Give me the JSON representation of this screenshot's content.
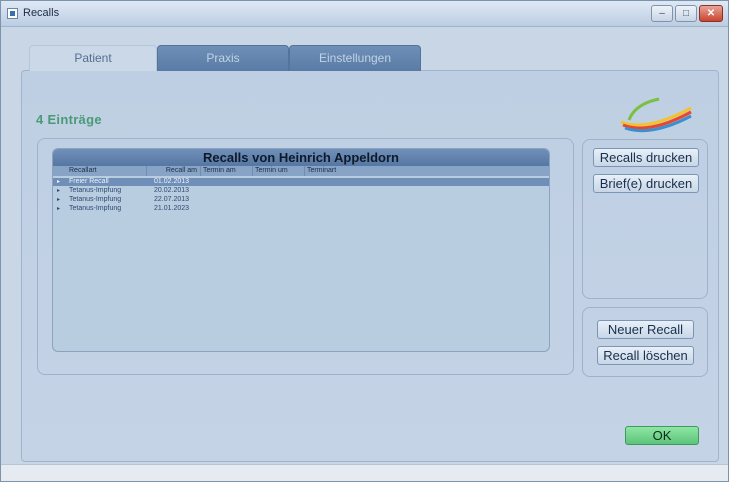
{
  "window": {
    "title": "Recalls"
  },
  "tabs": [
    {
      "label": "Patient"
    },
    {
      "label": "Praxis"
    },
    {
      "label": "Einstellungen"
    }
  ],
  "entry_count": "4 Einträge",
  "grid": {
    "title": "Recalls von Heinrich Appeldorn",
    "columns": [
      "Recallart",
      "Recall am",
      "Termin am",
      "Termin um",
      "Terminart"
    ],
    "rows": [
      {
        "recallart": "Freier Recall",
        "recall_am": "01.02.2013",
        "termin_am": "",
        "termin_um": "",
        "terminart": ""
      },
      {
        "recallart": "Tetanus-Impfung",
        "recall_am": "20.02.2013",
        "termin_am": "",
        "termin_um": "",
        "terminart": ""
      },
      {
        "recallart": "Tetanus-Impfung",
        "recall_am": "22.07.2013",
        "termin_am": "",
        "termin_um": "",
        "terminart": ""
      },
      {
        "recallart": "Tetanus-Impfung",
        "recall_am": "21.01.2023",
        "termin_am": "",
        "termin_um": "",
        "terminart": ""
      }
    ],
    "row_marker": "▸"
  },
  "buttons": {
    "recalls_drucken": "Recalls drucken",
    "briefe_drucken": "Brief(e) drucken",
    "neuer_recall": "Neuer Recall",
    "recall_loeschen": "Recall löschen",
    "ok": "OK"
  },
  "colors": {
    "accent": "#5677a3",
    "count_text": "#4a9a76",
    "ok_button": "#5bc47a"
  }
}
